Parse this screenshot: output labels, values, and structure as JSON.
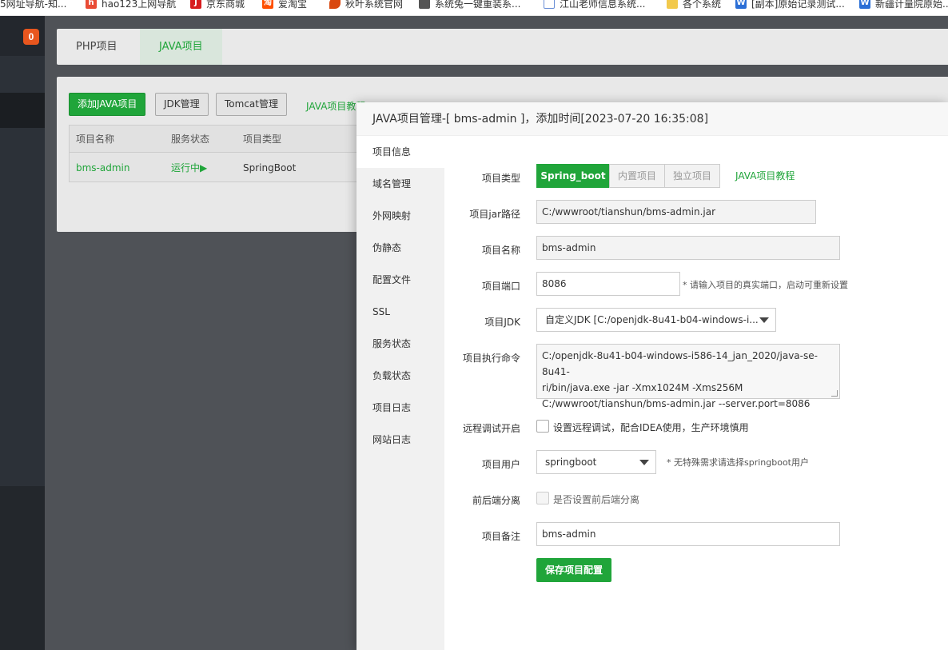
{
  "bookmarks": [
    {
      "label": "5网址导航-知...",
      "icon": "globe-icon",
      "color": "#888888"
    },
    {
      "label": "hao123上网导航",
      "icon": "hao123-icon",
      "color": "#e94b35"
    },
    {
      "label": "京东商城",
      "icon": "jd-icon",
      "color": "#d71c1e"
    },
    {
      "label": "爱淘宝",
      "icon": "aitaobao-icon",
      "color": "#ff5000"
    },
    {
      "label": "秋叶系统官网",
      "icon": "leaf-icon",
      "color": "#d9480f"
    },
    {
      "label": "系统兔一键重装系...",
      "icon": "rabbit-icon",
      "color": "#555555"
    },
    {
      "label": "江山老师信息系统...",
      "icon": "page-icon",
      "color": "#6a8fd6"
    },
    {
      "label": "各个系统",
      "icon": "folder-icon",
      "color": "#f2c94c"
    },
    {
      "label": "[副本]原始记录测试...",
      "icon": "word-doc-icon",
      "color": "#2b6fd6"
    },
    {
      "label": "新疆计量院原始...",
      "icon": "word-doc-icon",
      "color": "#2b6fd6"
    }
  ],
  "sidebar": {
    "badge_count": "0"
  },
  "tabs": [
    {
      "label": "PHP项目"
    },
    {
      "label": "JAVA项目"
    }
  ],
  "toolbar": {
    "add_java": "添加JAVA项目",
    "jdk_manage": "JDK管理",
    "tomcat_manage": "Tomcat管理",
    "java_tutorial": "JAVA项目教程"
  },
  "table": {
    "headers": [
      "项目名称",
      "服务状态",
      "项目类型"
    ],
    "rows": [
      {
        "name": "bms-admin",
        "status": "运行中▶",
        "type": "SpringBoot"
      }
    ]
  },
  "modal": {
    "title": "JAVA项目管理-[ bms-admin ]，添加时间[2023-07-20 16:35:08]",
    "nav": [
      "项目信息",
      "域名管理",
      "外网映射",
      "伪静态",
      "配置文件",
      "SSL",
      "服务状态",
      "负载状态",
      "项目日志",
      "网站日志"
    ],
    "form": {
      "type_label": "项目类型",
      "type_options": [
        "Spring_boot",
        "内置项目",
        "独立项目"
      ],
      "type_tutorial": "JAVA项目教程",
      "jar_label": "项目jar路径",
      "jar_value": "C:/wwwroot/tianshun/bms-admin.jar",
      "name_label": "项目名称",
      "name_value": "bms-admin",
      "port_label": "项目端口",
      "port_value": "8086",
      "port_hint": "* 请输入项目的真实端口，启动可重新设置",
      "jdk_label": "项目JDK",
      "jdk_value": "自定义JDK [C:/openjdk-8u41-b04-windows-i...",
      "cmd_label": "项目执行命令",
      "cmd_lines": [
        "C:/openjdk-8u41-b04-windows-i586-14_jan_2020/java-se-8u41-",
        "ri/bin/java.exe -jar -Xmx1024M -Xms256M",
        "C:/wwwroot/tianshun/bms-admin.jar --server.port=8086"
      ],
      "debug_label": "远程调试开启",
      "debug_text": "设置远程调试，配合IDEA使用，生产环境慎用",
      "user_label": "项目用户",
      "user_value": "springboot",
      "user_hint": "* 无特殊需求请选择springboot用户",
      "sep_label": "前后端分离",
      "sep_text": "是否设置前后端分离",
      "remark_label": "项目备注",
      "remark_value": "bms-admin",
      "save_label": "保存项目配置"
    }
  },
  "colors": {
    "accent": "#20a53a",
    "badge": "#e8561e"
  }
}
